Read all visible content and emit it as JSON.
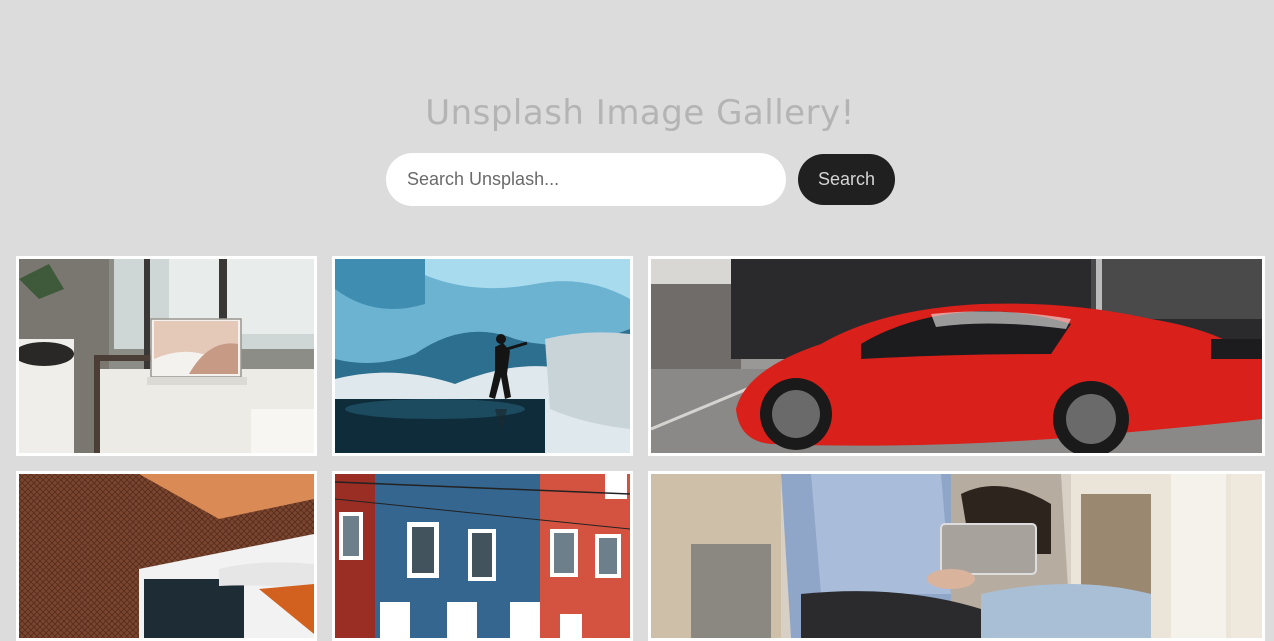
{
  "header": {
    "title": "Unsplash Image Gallery!"
  },
  "search": {
    "placeholder": "Search Unsplash...",
    "value": "",
    "button_label": "Search"
  },
  "gallery": {
    "images": [
      {
        "subject": "laptop on white bench by window"
      },
      {
        "subject": "person exploring blue ice cave"
      },
      {
        "subject": "red sports car in parking lot"
      },
      {
        "subject": "modern building with brown mesh facade"
      },
      {
        "subject": "colorful row houses"
      },
      {
        "subject": "couple sitting with tablet"
      }
    ]
  },
  "colors": {
    "background": "#dcdcdc",
    "title": "#b4b4b4",
    "button_bg": "#202020",
    "button_text": "#d4d4d4",
    "tile_border": "#ffffff"
  }
}
